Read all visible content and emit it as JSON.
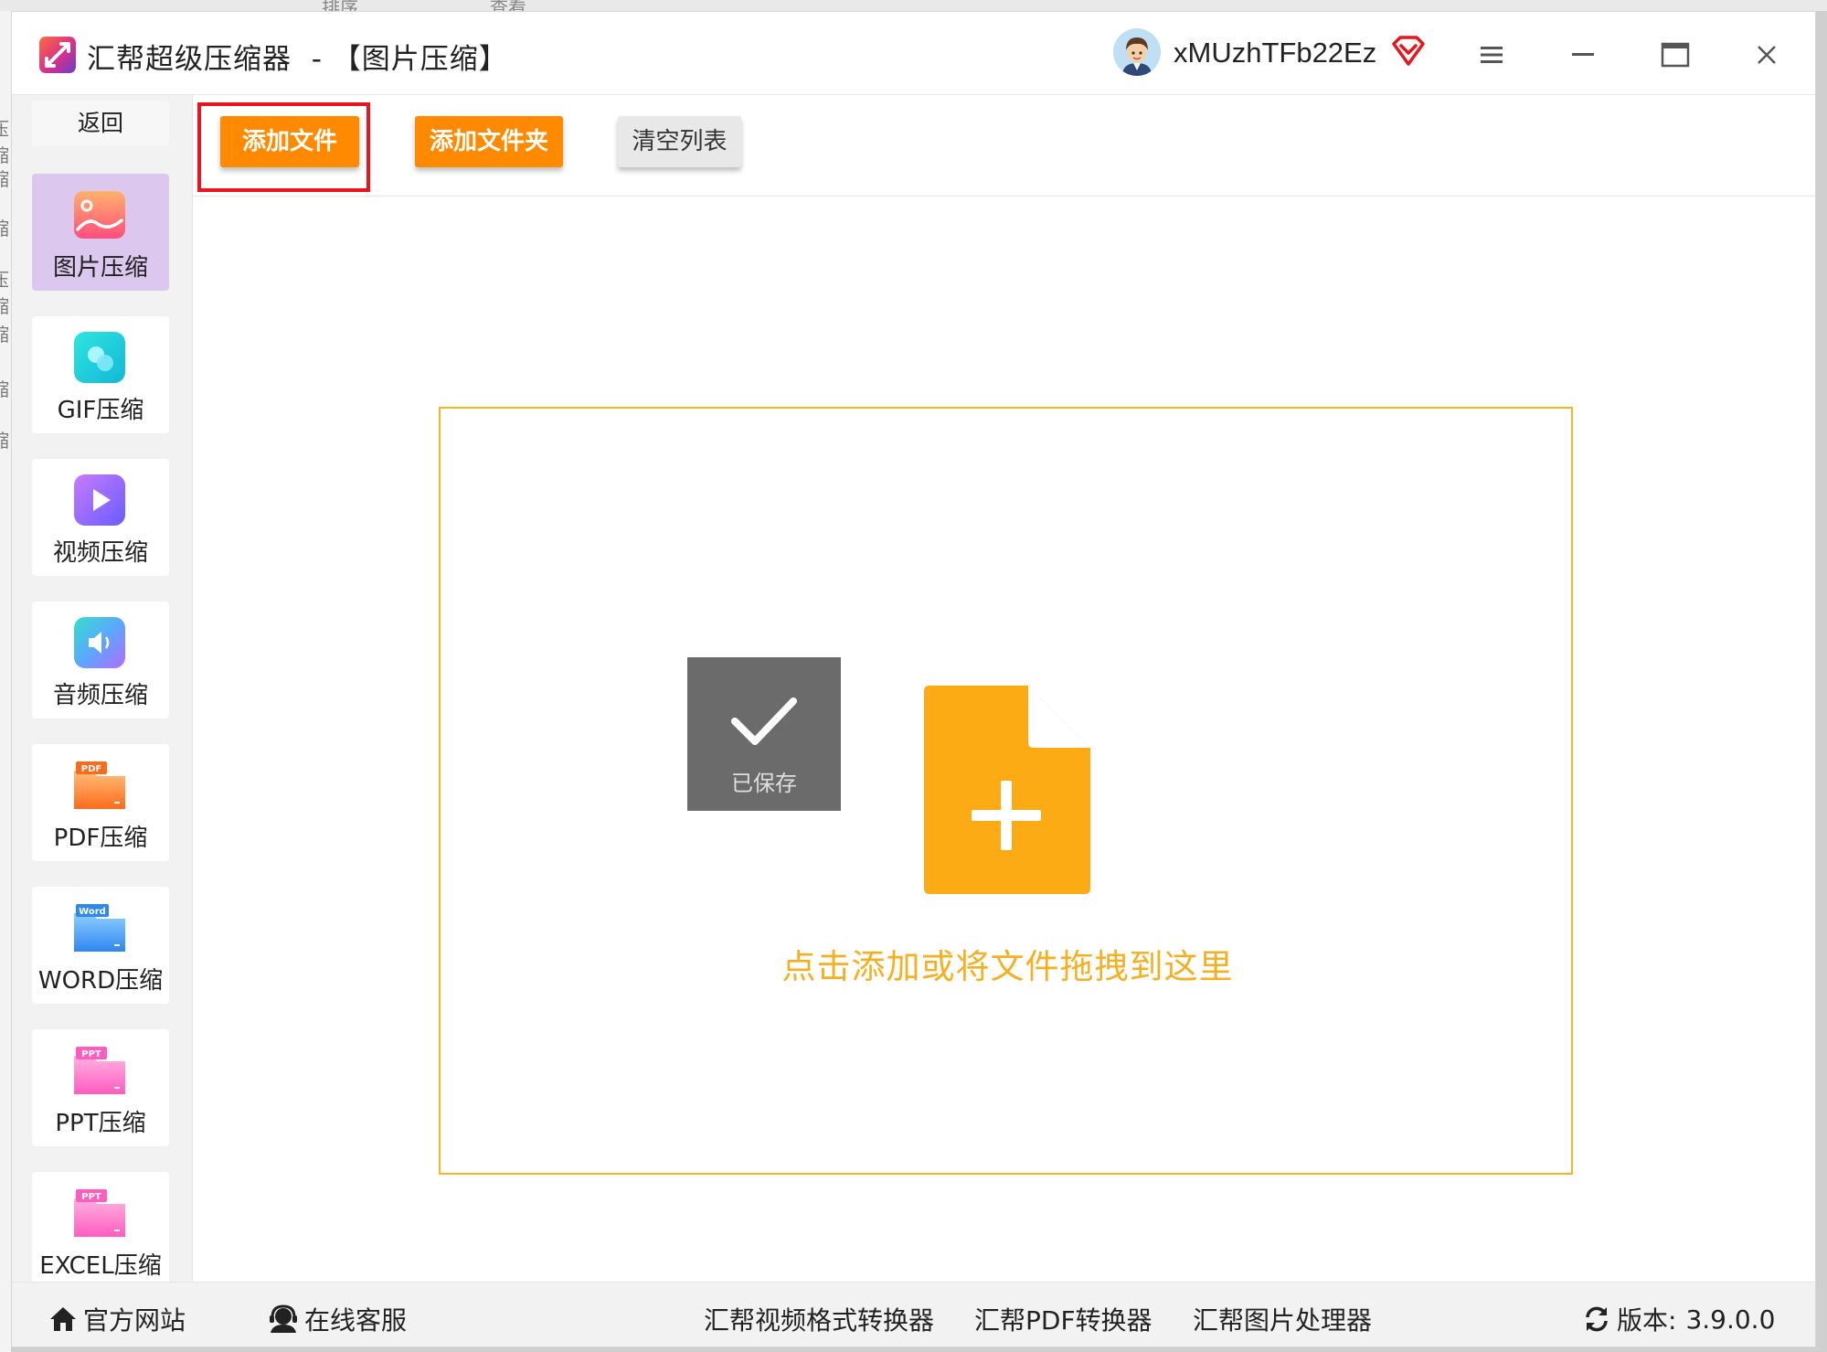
{
  "background": {
    "top_text": [
      "排序",
      "查看"
    ],
    "left_text": [
      "压缩",
      "缩",
      "缩",
      "压缩",
      "缩",
      "缩",
      "缩"
    ]
  },
  "titlebar": {
    "app_name": "汇帮超级压缩器",
    "separator": "-",
    "section": "【图片压缩】",
    "username": "xMUzhTFb22Ez",
    "icons": [
      "app-logo-icon",
      "avatar",
      "vip-diamond-icon",
      "menu-icon",
      "minimize-icon",
      "maximize-icon",
      "close-icon"
    ]
  },
  "sidebar": {
    "back_label": "返回",
    "items": [
      {
        "label": "图片压缩",
        "icon": "image-compress-icon",
        "active": true
      },
      {
        "label": "GIF压缩",
        "icon": "gif-compress-icon",
        "active": false
      },
      {
        "label": "视频压缩",
        "icon": "video-compress-icon",
        "active": false
      },
      {
        "label": "音频压缩",
        "icon": "audio-compress-icon",
        "active": false
      },
      {
        "label": "PDF压缩",
        "icon": "pdf-compress-icon",
        "icon_text": "PDF",
        "active": false
      },
      {
        "label": "WORD压缩",
        "icon": "word-compress-icon",
        "icon_text": "Word",
        "active": false
      },
      {
        "label": "PPT压缩",
        "icon": "ppt-compress-icon",
        "icon_text": "PPT",
        "active": false
      },
      {
        "label": "EXCEL压缩",
        "icon": "excel-compress-icon",
        "icon_text": "PPT",
        "active": false
      }
    ]
  },
  "toolbar": {
    "add_file": "添加文件",
    "add_folder": "添加文件夹",
    "clear_list": "清空列表"
  },
  "dropzone": {
    "saved_label": "已保存",
    "hint": "点击添加或将文件拖拽到这里"
  },
  "statusbar": {
    "website": "官方网站",
    "support": "在线客服",
    "links": [
      "汇帮视频格式转换器",
      "汇帮PDF转换器",
      "汇帮图片处理器"
    ],
    "version_label": "版本:",
    "version": "3.9.0.0"
  },
  "colors": {
    "accent_orange": "#ff8a00",
    "drop_border": "#f6b523",
    "highlight_red": "#e8161c",
    "active_sidebar": "#dcc7ef"
  }
}
